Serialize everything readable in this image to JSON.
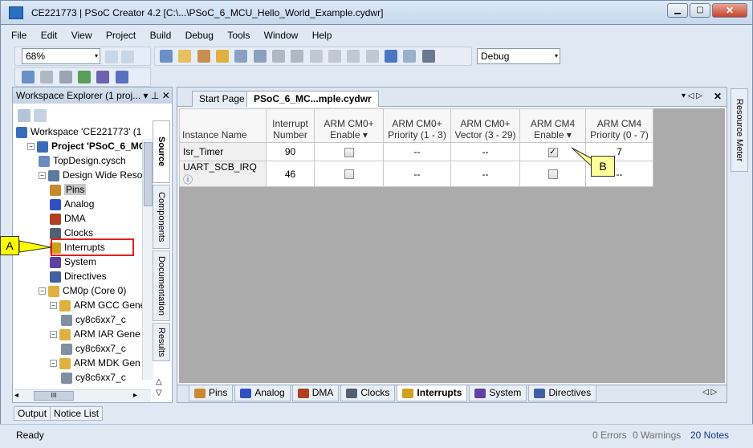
{
  "window": {
    "title": "CE221773 | PSoC Creator 4.2  [C:\\...\\PSoC_6_MCU_Hello_World_Example.cydwr]",
    "min": "▁",
    "max": "▢",
    "close": "✕"
  },
  "menu": [
    "File",
    "Edit",
    "View",
    "Project",
    "Build",
    "Debug",
    "Tools",
    "Window",
    "Help"
  ],
  "toolbar": {
    "zoom": "68%",
    "config": "Debug"
  },
  "workspace": {
    "header": "Workspace Explorer (1 proj...",
    "tree": [
      {
        "label": "Workspace 'CE221773' (1",
        "level": 0,
        "toggle": ""
      },
      {
        "label": "Project  'PSoC_6_MC",
        "level": 1,
        "toggle": "−",
        "bold": true
      },
      {
        "label": "TopDesign.cysch",
        "level": 2,
        "toggle": ""
      },
      {
        "label": "Design Wide Resou",
        "level": 2,
        "toggle": "−"
      },
      {
        "label": "Pins",
        "level": 3,
        "toggle": "",
        "selected": true
      },
      {
        "label": "Analog",
        "level": 3,
        "toggle": ""
      },
      {
        "label": "DMA",
        "level": 3,
        "toggle": ""
      },
      {
        "label": "Clocks",
        "level": 3,
        "toggle": ""
      },
      {
        "label": "Interrupts",
        "level": 3,
        "toggle": ""
      },
      {
        "label": "System",
        "level": 3,
        "toggle": ""
      },
      {
        "label": "Directives",
        "level": 3,
        "toggle": ""
      },
      {
        "label": "CM0p (Core 0)",
        "level": 2,
        "toggle": "−"
      },
      {
        "label": "ARM GCC Gene",
        "level": 3,
        "toggle": "−"
      },
      {
        "label": "cy8c6xx7_c",
        "level": 4,
        "toggle": ""
      },
      {
        "label": "ARM IAR Gene",
        "level": 3,
        "toggle": "−"
      },
      {
        "label": "cy8c6xx7_c",
        "level": 4,
        "toggle": ""
      },
      {
        "label": "ARM MDK Gen",
        "level": 3,
        "toggle": "−"
      },
      {
        "label": "cy8c6xx7_c",
        "level": 4,
        "toggle": ""
      }
    ],
    "side_tabs": [
      "Source",
      "Components",
      "Documentation",
      "Results"
    ],
    "scroll_label": "III"
  },
  "doc_tabs": [
    {
      "label": "Start Page",
      "active": false
    },
    {
      "label": "PSoC_6_MC...mple.cydwr",
      "active": true
    }
  ],
  "table": {
    "headers": [
      "Instance Name",
      "Interrupt Number",
      "ARM CM0+ Enable",
      "ARM CM0+ Priority (1 - 3)",
      "ARM CM0+ Vector (3 - 29)",
      "ARM CM4 Enable",
      "ARM CM4 Priority (0 - 7)"
    ],
    "rows": [
      {
        "name": "Isr_Timer",
        "number": "90",
        "cm0_enable": false,
        "cm0_priority": "--",
        "cm0_vector": "--",
        "cm4_enable": true,
        "cm4_priority": "7"
      },
      {
        "name": "UART_SCB_IRQ",
        "number": "46",
        "cm0_enable": false,
        "cm0_priority": "--",
        "cm0_vector": "--",
        "cm4_enable": false,
        "cm4_priority": "--"
      }
    ]
  },
  "bottom_tabs": [
    {
      "label": "Pins",
      "active": false,
      "color": "#c98a2e"
    },
    {
      "label": "Analog",
      "active": false,
      "color": "#3050c0"
    },
    {
      "label": "DMA",
      "active": false,
      "color": "#b04020"
    },
    {
      "label": "Clocks",
      "active": false,
      "color": "#506070"
    },
    {
      "label": "Interrupts",
      "active": true,
      "color": "#d0a020"
    },
    {
      "label": "System",
      "active": false,
      "color": "#6040a0"
    },
    {
      "label": "Directives",
      "active": false,
      "color": "#4060a0"
    }
  ],
  "resource_meter": "Resource Meter",
  "output_tabs": [
    "Output",
    "Notice List"
  ],
  "status": {
    "ready": "Ready",
    "errors": "0 Errors",
    "warnings": "0 Warnings",
    "notes": "20 Notes"
  },
  "callouts": {
    "a": "A",
    "b": "B"
  },
  "glyphs": {
    "check": "✓",
    "pin": "⊥",
    "close": "✕",
    "dropdown": "▾",
    "tab_menu": "▾ ◁ ▷",
    "scroll_nav": "◁ ▷",
    "scroll_up": "△",
    "scroll_down": "▽",
    "left": "◂",
    "right": "▸",
    "sort": "▾",
    "info": "ⓘ"
  }
}
